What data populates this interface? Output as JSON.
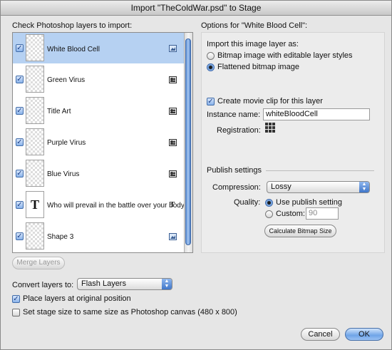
{
  "window": {
    "title": "Import \"TheColdWar.psd\" to Stage"
  },
  "layers": {
    "heading": "Check Photoshop layers to import:",
    "items": [
      {
        "name": "White Blood Cell",
        "checked": true,
        "selected": true,
        "type_icon": "bitmap-icon"
      },
      {
        "name": "Green Virus",
        "checked": true,
        "selected": false,
        "type_icon": "movie-clip-icon"
      },
      {
        "name": "Title Art",
        "checked": true,
        "selected": false,
        "type_icon": "movie-clip-icon"
      },
      {
        "name": "Purple Virus",
        "checked": true,
        "selected": false,
        "type_icon": "movie-clip-icon"
      },
      {
        "name": "Blue Virus",
        "checked": true,
        "selected": false,
        "type_icon": "movie-clip-icon"
      },
      {
        "name": "Who will prevail in the battle over your body",
        "checked": true,
        "selected": false,
        "thumb_text": "T",
        "type_icon": "text-icon",
        "type_glyph": "T"
      },
      {
        "name": "Shape 3",
        "checked": true,
        "selected": false,
        "type_icon": "bitmap-icon"
      }
    ],
    "merge_button": "Merge Layers"
  },
  "options": {
    "heading": "Options for \"White Blood Cell\":",
    "import_as_label": "Import this image layer as:",
    "radio_bitmap_editable": "Bitmap image with editable layer styles",
    "radio_flattened": "Flattened bitmap image",
    "create_movie_clip": "Create movie clip for this layer",
    "instance_name_label": "Instance name:",
    "instance_name_value": "whiteBloodCell",
    "registration_label": "Registration:",
    "publish_heading": "Publish settings",
    "compression_label": "Compression:",
    "compression_value": "Lossy",
    "quality_label": "Quality:",
    "use_publish_setting": "Use publish setting",
    "custom_label": "Custom:",
    "custom_value": "90",
    "calc_button": "Calculate Bitmap Size"
  },
  "footer": {
    "convert_label": "Convert layers to:",
    "convert_value": "Flash Layers",
    "place_original": "Place layers at original position",
    "set_stage_size": "Set stage size to same size as Photoshop canvas (480 x 800)",
    "cancel": "Cancel",
    "ok": "OK"
  },
  "colors": {
    "accent": "#6fa4e8",
    "selection": "#b6d1f2"
  }
}
